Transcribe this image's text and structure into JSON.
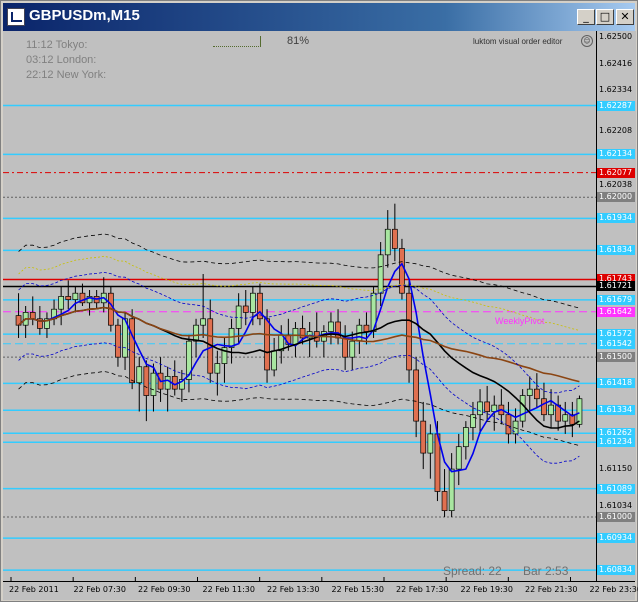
{
  "window": {
    "title": "GBPUSDm,M15",
    "minimize_glyph": "_",
    "maximize_glyph": "□",
    "close_glyph": "✕"
  },
  "clocks": [
    {
      "time": "11:12",
      "city": "Tokyo:"
    },
    {
      "time": "03:12",
      "city": "London:"
    },
    {
      "time": "22:12",
      "city": "New York:"
    }
  ],
  "percent_indicator": "81%",
  "ea_label": "luktom visual order editor",
  "weekly_pivot_label": "WeeklyPivot",
  "spread_text": "Spread: 22",
  "bar_text": "Bar  2:53",
  "price_labels": [
    "1.62500",
    "1.62416",
    "1.62334",
    "1.62287",
    "1.62208",
    "1.62134",
    "1.62077",
    "1.62038",
    "1.62000",
    "1.61934",
    "1.61834",
    "1.61743",
    "1.61721",
    "1.61679",
    "1.61642",
    "1.61572",
    "1.61542",
    "1.61500",
    "1.61418",
    "1.61334",
    "1.61262",
    "1.61234",
    "1.61150",
    "1.61089",
    "1.61034",
    "1.61000",
    "1.60934",
    "1.60834"
  ],
  "time_labels": [
    "22 Feb 2011",
    "22 Feb 07:30",
    "22 Feb 09:30",
    "22 Feb 11:30",
    "22 Feb 13:30",
    "22 Feb 15:30",
    "22 Feb 17:30",
    "22 Feb 19:30",
    "22 Feb 21:30",
    "22 Feb 23:30"
  ],
  "chart_data": {
    "type": "candlestick",
    "symbol": "GBPUSDm",
    "timeframe": "M15",
    "ylim": [
      1.608,
      1.6252
    ],
    "y_ticks": [
      1.625,
      1.62416,
      1.62334,
      1.62287,
      1.62208,
      1.62134,
      1.62077,
      1.62038,
      1.62,
      1.61934,
      1.61834,
      1.61743,
      1.61721,
      1.61679,
      1.61642,
      1.61572,
      1.61542,
      1.615,
      1.61418,
      1.61334,
      1.61262,
      1.61234,
      1.6115,
      1.61089,
      1.61034,
      1.61,
      1.60934,
      1.60834
    ],
    "x_ticks": [
      "22 Feb 2011",
      "22 Feb 07:30",
      "22 Feb 09:30",
      "22 Feb 11:30",
      "22 Feb 13:30",
      "22 Feb 15:30",
      "22 Feb 17:30",
      "22 Feb 19:30",
      "22 Feb 21:30",
      "22 Feb 23:30"
    ],
    "levels": [
      {
        "price": 1.62287,
        "color": "#33ccff",
        "style": "solid",
        "label_bg": "#33ccff"
      },
      {
        "price": 1.62134,
        "color": "#33ccff",
        "style": "solid",
        "label_bg": "#33ccff"
      },
      {
        "price": 1.62077,
        "color": "#dd0000",
        "style": "dashdot",
        "label_bg": "#dd0000"
      },
      {
        "price": 1.62,
        "color": "#606060",
        "style": "dotted",
        "label_bg": "#808080"
      },
      {
        "price": 1.61934,
        "color": "#33ccff",
        "style": "solid",
        "label_bg": "#33ccff"
      },
      {
        "price": 1.61834,
        "color": "#33ccff",
        "style": "solid",
        "label_bg": "#33ccff"
      },
      {
        "price": 1.61743,
        "color": "#dd0000",
        "style": "solid",
        "label_bg": "#dd0000"
      },
      {
        "price": 1.61721,
        "color": "#000000",
        "style": "solid",
        "label_bg": "#000000"
      },
      {
        "price": 1.61679,
        "color": "#33ccff",
        "style": "solid",
        "label_bg": "#33ccff"
      },
      {
        "price": 1.61642,
        "color": "#ff33ff",
        "style": "dashed",
        "label_bg": "#ff33ff"
      },
      {
        "price": 1.61572,
        "color": "#33ccff",
        "style": "solid",
        "label_bg": "#33ccff"
      },
      {
        "price": 1.61542,
        "color": "#33ccff",
        "style": "dashed",
        "label_bg": "#33ccff"
      },
      {
        "price": 1.615,
        "color": "#606060",
        "style": "dotted",
        "label_bg": "#808080"
      },
      {
        "price": 1.61418,
        "color": "#33ccff",
        "style": "solid",
        "label_bg": "#33ccff"
      },
      {
        "price": 1.61334,
        "color": "#33ccff",
        "style": "solid",
        "label_bg": "#33ccff"
      },
      {
        "price": 1.61262,
        "color": "#33ccff",
        "style": "solid",
        "label_bg": "#33ccff"
      },
      {
        "price": 1.61234,
        "color": "#33ccff",
        "style": "solid",
        "label_bg": "#33ccff"
      },
      {
        "price": 1.61089,
        "color": "#33ccff",
        "style": "solid",
        "label_bg": "#33ccff"
      },
      {
        "price": 1.61,
        "color": "#606060",
        "style": "dotted",
        "label_bg": "#808080"
      },
      {
        "price": 1.60934,
        "color": "#33ccff",
        "style": "solid",
        "label_bg": "#33ccff"
      },
      {
        "price": 1.60834,
        "color": "#33ccff",
        "style": "solid",
        "label_bg": "#33ccff"
      }
    ],
    "candles": [
      [
        1.6163,
        1.617,
        1.6156,
        1.616
      ],
      [
        1.616,
        1.6166,
        1.6156,
        1.6164
      ],
      [
        1.6164,
        1.6169,
        1.616,
        1.6162
      ],
      [
        1.6162,
        1.6166,
        1.6157,
        1.6159
      ],
      [
        1.6159,
        1.6164,
        1.6156,
        1.6162
      ],
      [
        1.6162,
        1.6168,
        1.616,
        1.6165
      ],
      [
        1.6165,
        1.6172,
        1.616,
        1.6169
      ],
      [
        1.6169,
        1.6174,
        1.6165,
        1.6168
      ],
      [
        1.6168,
        1.6172,
        1.6164,
        1.617
      ],
      [
        1.617,
        1.6173,
        1.6166,
        1.6167
      ],
      [
        1.6167,
        1.6171,
        1.6163,
        1.6169
      ],
      [
        1.6169,
        1.6171,
        1.6165,
        1.6167
      ],
      [
        1.6167,
        1.6175,
        1.6164,
        1.617
      ],
      [
        1.617,
        1.6172,
        1.6158,
        1.616
      ],
      [
        1.616,
        1.6162,
        1.6147,
        1.615
      ],
      [
        1.615,
        1.6164,
        1.6146,
        1.6162
      ],
      [
        1.6162,
        1.6165,
        1.614,
        1.6142
      ],
      [
        1.6142,
        1.615,
        1.6133,
        1.6147
      ],
      [
        1.6147,
        1.6149,
        1.613,
        1.6138
      ],
      [
        1.6138,
        1.6148,
        1.6133,
        1.6145
      ],
      [
        1.6145,
        1.615,
        1.6136,
        1.614
      ],
      [
        1.614,
        1.6147,
        1.6133,
        1.6144
      ],
      [
        1.6144,
        1.6149,
        1.6138,
        1.614
      ],
      [
        1.614,
        1.6146,
        1.6136,
        1.6143
      ],
      [
        1.6143,
        1.6157,
        1.6139,
        1.6155
      ],
      [
        1.6155,
        1.6162,
        1.615,
        1.616
      ],
      [
        1.616,
        1.6176,
        1.6156,
        1.6162
      ],
      [
        1.6162,
        1.6168,
        1.6142,
        1.6145
      ],
      [
        1.6145,
        1.6152,
        1.6138,
        1.6148
      ],
      [
        1.6148,
        1.6156,
        1.6142,
        1.6153
      ],
      [
        1.6153,
        1.6162,
        1.6148,
        1.6159
      ],
      [
        1.6159,
        1.617,
        1.6154,
        1.6166
      ],
      [
        1.6166,
        1.6171,
        1.616,
        1.6164
      ],
      [
        1.6164,
        1.6172,
        1.616,
        1.617
      ],
      [
        1.617,
        1.6173,
        1.616,
        1.6162
      ],
      [
        1.6162,
        1.6165,
        1.6142,
        1.6146
      ],
      [
        1.6146,
        1.6156,
        1.6144,
        1.6152
      ],
      [
        1.6152,
        1.616,
        1.6148,
        1.6157
      ],
      [
        1.6157,
        1.6162,
        1.6152,
        1.6154
      ],
      [
        1.6154,
        1.6161,
        1.615,
        1.6159
      ],
      [
        1.6159,
        1.6163,
        1.6154,
        1.6156
      ],
      [
        1.6156,
        1.6161,
        1.615,
        1.6158
      ],
      [
        1.6158,
        1.6164,
        1.6153,
        1.6155
      ],
      [
        1.6155,
        1.616,
        1.615,
        1.6158
      ],
      [
        1.6158,
        1.6164,
        1.6154,
        1.6161
      ],
      [
        1.6161,
        1.6165,
        1.6154,
        1.6156
      ],
      [
        1.6156,
        1.616,
        1.6146,
        1.615
      ],
      [
        1.615,
        1.6158,
        1.6146,
        1.6155
      ],
      [
        1.6155,
        1.6162,
        1.6151,
        1.616
      ],
      [
        1.616,
        1.6164,
        1.6154,
        1.6158
      ],
      [
        1.6158,
        1.6172,
        1.6156,
        1.617
      ],
      [
        1.617,
        1.6186,
        1.6166,
        1.6182
      ],
      [
        1.6182,
        1.6196,
        1.6178,
        1.619
      ],
      [
        1.619,
        1.6198,
        1.618,
        1.6184
      ],
      [
        1.6184,
        1.6187,
        1.6168,
        1.617
      ],
      [
        1.617,
        1.6174,
        1.6142,
        1.6146
      ],
      [
        1.6146,
        1.615,
        1.6125,
        1.613
      ],
      [
        1.613,
        1.6136,
        1.6115,
        1.612
      ],
      [
        1.612,
        1.6129,
        1.6112,
        1.6126
      ],
      [
        1.6126,
        1.613,
        1.6105,
        1.6108
      ],
      [
        1.6108,
        1.6115,
        1.61,
        1.6102
      ],
      [
        1.6102,
        1.612,
        1.61,
        1.6115
      ],
      [
        1.6115,
        1.6126,
        1.611,
        1.6122
      ],
      [
        1.6122,
        1.613,
        1.6118,
        1.6128
      ],
      [
        1.6128,
        1.6136,
        1.6124,
        1.6132
      ],
      [
        1.6132,
        1.614,
        1.6126,
        1.6136
      ],
      [
        1.6136,
        1.6141,
        1.613,
        1.6133
      ],
      [
        1.6133,
        1.6138,
        1.6127,
        1.6135
      ],
      [
        1.6135,
        1.614,
        1.6129,
        1.6132
      ],
      [
        1.6132,
        1.6136,
        1.6123,
        1.6126
      ],
      [
        1.6126,
        1.6134,
        1.6123,
        1.613
      ],
      [
        1.613,
        1.614,
        1.6128,
        1.6138
      ],
      [
        1.6138,
        1.6144,
        1.6133,
        1.614
      ],
      [
        1.614,
        1.6145,
        1.6134,
        1.6137
      ],
      [
        1.6137,
        1.6142,
        1.613,
        1.6132
      ],
      [
        1.6132,
        1.614,
        1.6128,
        1.6135
      ],
      [
        1.6135,
        1.6138,
        1.6127,
        1.613
      ],
      [
        1.613,
        1.6136,
        1.6126,
        1.6132
      ],
      [
        1.6132,
        1.6136,
        1.6125,
        1.6129
      ],
      [
        1.6129,
        1.6138,
        1.6128,
        1.6137
      ]
    ]
  }
}
